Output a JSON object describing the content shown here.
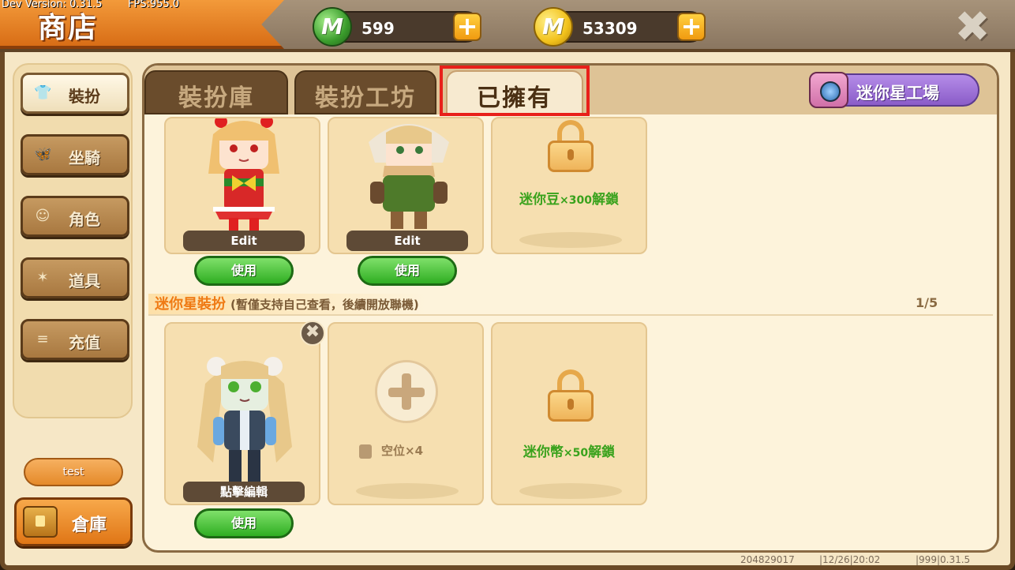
{
  "debug": {
    "version": "Dev Version: 0.31.5",
    "fps": "FPS:955.0"
  },
  "header": {
    "title": "商店"
  },
  "currency": {
    "gems": {
      "icon": "green-gem-icon",
      "value": "599",
      "symbol": "M"
    },
    "coins": {
      "icon": "gold-m-coin-icon",
      "value": "53309",
      "symbol": "M"
    },
    "plus": "+"
  },
  "close": "✖",
  "sidebar": {
    "items": [
      {
        "label": "裝扮",
        "icon": "shirt-icon",
        "glyph": "👕",
        "active": true
      },
      {
        "label": "坐騎",
        "icon": "butterfly-icon",
        "glyph": "🦋",
        "active": false
      },
      {
        "label": "角色",
        "icon": "character-icon",
        "glyph": "☺",
        "active": false
      },
      {
        "label": "道具",
        "icon": "party-popper-icon",
        "glyph": "✶",
        "active": false
      },
      {
        "label": "充值",
        "icon": "coin-stack-icon",
        "glyph": "≡",
        "active": false
      }
    ],
    "test_label": "test",
    "warehouse_label": "倉庫"
  },
  "tabs": [
    {
      "label": "裝扮庫",
      "active": false
    },
    {
      "label": "裝扮工坊",
      "active": false
    },
    {
      "label": "已擁有",
      "active": true
    }
  ],
  "workshop": {
    "label": "迷你星工場",
    "icon": "camera-icon"
  },
  "owned": {
    "cards": [
      {
        "bar": "Edit",
        "button": "使用"
      },
      {
        "bar": "Edit",
        "button": "使用"
      },
      {
        "unlock": "迷你豆",
        "unlock_qty": "×300",
        "unlock_suffix": "解鎖"
      }
    ]
  },
  "ministar": {
    "title": "迷你星裝扮",
    "note": "(暫僅支持自己查看，後續開放聯機)",
    "page": "1/5",
    "remove": "✖",
    "cards": [
      {
        "bar": "點擊編輯",
        "button": "使用"
      },
      {
        "slot_label": "空位",
        "slot_qty": "×4"
      },
      {
        "unlock": "迷你幣",
        "unlock_qty": "×50",
        "unlock_suffix": "解鎖"
      }
    ]
  },
  "footer": {
    "uid": "204829017",
    "date": "|12/26|20:02",
    "build": "|999|0.31.5"
  },
  "colors": {
    "accent_orange": "#e07616",
    "green_button": "#2fae22",
    "active_tab_outline": "#e8201a",
    "workshop_purple": "#8a5cc8"
  }
}
